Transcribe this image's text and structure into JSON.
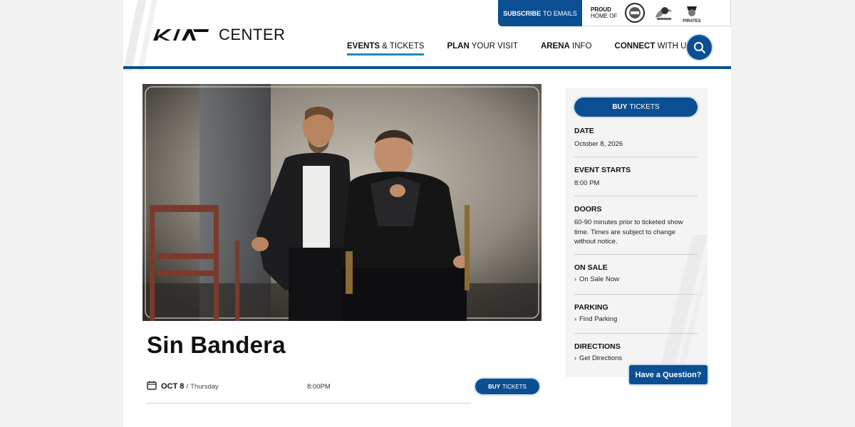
{
  "brand": {
    "logo_text": "KIA",
    "logo_suffix": "CENTER"
  },
  "topbar": {
    "subscribe_bold": "SUBSCRIBE",
    "subscribe_rest": "TO EMAILS",
    "proud_bold": "PROUD",
    "proud_rest": "HOME OF",
    "team_logos": [
      "team-logo-1",
      "team-logo-2",
      "pirates-logo"
    ],
    "pirates_label": "PIRATES"
  },
  "nav": [
    {
      "bold": "EVENTS",
      "rest": "& TICKETS",
      "active": true
    },
    {
      "bold": "PLAN",
      "rest": "YOUR VISIT",
      "active": false
    },
    {
      "bold": "ARENA",
      "rest": "INFO",
      "active": false
    },
    {
      "bold": "CONNECT",
      "rest": "WITH US",
      "active": false
    }
  ],
  "search": {
    "icon": "search-icon"
  },
  "event": {
    "title": "Sin Bandera",
    "date_short": "OCT 8",
    "separator": "/",
    "day": "Thursday",
    "time": "8:00PM",
    "buy_bold": "BUY",
    "buy_rest": "TICKETS"
  },
  "sidebar": {
    "buy_bold": "BUY",
    "buy_rest": "TICKETS",
    "date_label": "DATE",
    "date_value": "October 8, 2026",
    "starts_label": "EVENT STARTS",
    "starts_value": "8:00 PM",
    "doors_label": "DOORS",
    "doors_value": "60-90 minutes prior to ticketed show time. Times are subject to change without notice.",
    "onsale_label": "ON SALE",
    "onsale_link": "On Sale Now",
    "parking_label": "PARKING",
    "parking_link": "Find Parking",
    "directions_label": "DIRECTIONS",
    "directions_link": "Get Directions"
  },
  "help": {
    "question_label": "Have a Question?"
  },
  "colors": {
    "primary": "#0b4f92",
    "accent": "#1a8fb8"
  }
}
